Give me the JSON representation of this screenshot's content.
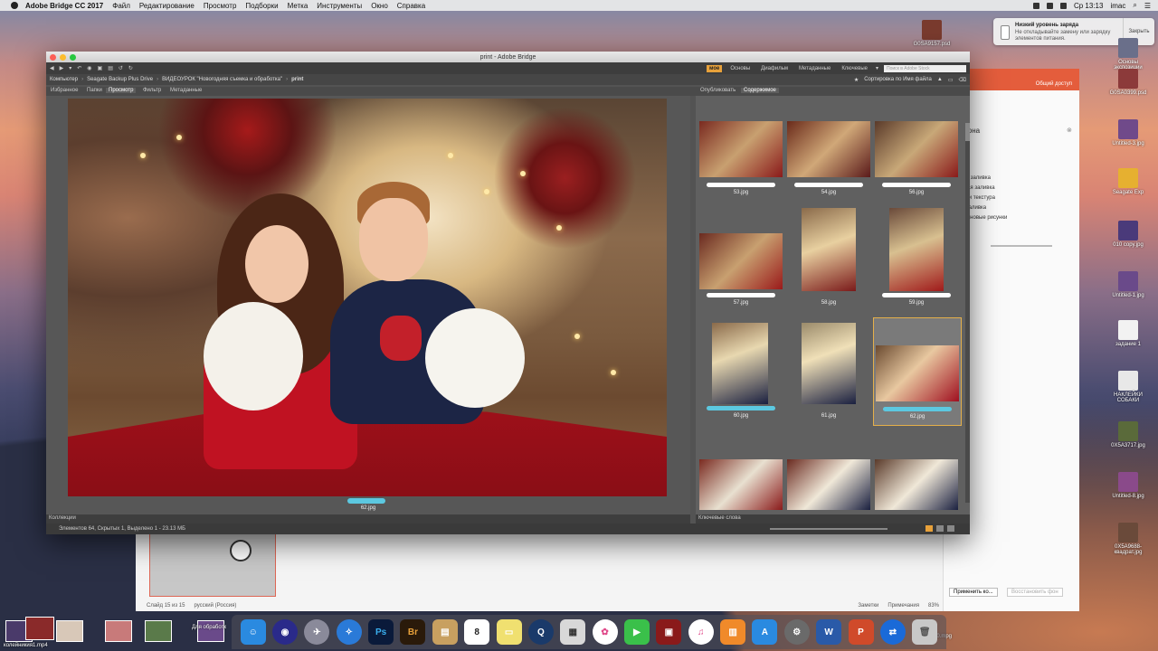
{
  "menubar": {
    "app": "Adobe Bridge CC 2017",
    "items": [
      "Файл",
      "Редактирование",
      "Просмотр",
      "Подборки",
      "Метка",
      "Инструменты",
      "Окно",
      "Справка"
    ],
    "clock": "Ср 13:13",
    "user": "imac"
  },
  "notification": {
    "title": "Низкий уровень заряда",
    "body": "Не откладывайте замену или зарядку элементов питания.",
    "button": "Закрыть"
  },
  "desktop_icons": [
    {
      "label": "G0SA9157.psd"
    },
    {
      "label": "Основы экспозиции"
    },
    {
      "label": "G0SA0399.psd"
    },
    {
      "label": "Untitled-3.jpg"
    },
    {
      "label": "Seagate Exp"
    },
    {
      "label": "010 copy.jpg"
    },
    {
      "label": "Untitled-1.jpg"
    },
    {
      "label": "задание 1"
    },
    {
      "label": "НАКЛЕЙКИ СОБАКИ"
    },
    {
      "label": "0X5A3717.jpg"
    },
    {
      "label": "Untitled-8.jpg"
    },
    {
      "label": "0X5A9688-квадрат.jpg"
    }
  ],
  "window": {
    "title": "print - Adobe Bridge"
  },
  "toolbar": {
    "workspaces": [
      "мое",
      "Основы",
      "Диафильм",
      "Метаданные",
      "Ключевые"
    ],
    "search_placeholder": "Поиск в Adobe Stock"
  },
  "path": {
    "items": [
      "Компьютер",
      "Seagate Backup Plus Drive",
      "ВИДЕОУРОК \"Новогодняя съемка и обработка\"",
      "print"
    ],
    "sort": "Сортировка по Имя файла"
  },
  "left_tabs": [
    "Избранное",
    "Папки",
    "Просмотр",
    "Фильтр",
    "Метаданные"
  ],
  "right_tabs": [
    "Опубликовать",
    "Содержимое"
  ],
  "preview": {
    "filename": "62.jpg"
  },
  "panels": {
    "collections": "Коллекции",
    "keywords": "Ключевые слова"
  },
  "status": "Элементов 64, Скрытых 1, Выделено 1 - 23.13 МБ",
  "thumbnails": [
    {
      "name": "53.jpg",
      "bar": "white"
    },
    {
      "name": "54.jpg",
      "bar": "white"
    },
    {
      "name": "56.jpg",
      "bar": "white"
    },
    {
      "name": "57.jpg",
      "bar": "white"
    },
    {
      "name": "58.jpg",
      "bar": "none"
    },
    {
      "name": "59.jpg",
      "bar": "white"
    },
    {
      "name": "60.jpg",
      "bar": "cyan"
    },
    {
      "name": "61.jpg",
      "bar": "none"
    },
    {
      "name": "62.jpg",
      "bar": "cyan",
      "selected": true
    }
  ],
  "ppt": {
    "share": "Общий доступ",
    "slide_status": "Слайд 15 из 15",
    "lang": "русский (Россия)",
    "notes": "Заметки",
    "comments": "Примечания",
    "zoom": "83%",
    "apply_btn": "Применить ко...",
    "restore_btn": "Восстановить фон",
    "panel_title": "ат фона",
    "options": [
      "ошная заливка",
      "иентная заливка",
      "нок или текстура",
      "рная заливка",
      "ить фоновые рисунки"
    ]
  },
  "dock": [
    "Finder",
    "Siri",
    "Launchpad",
    "Safari",
    "Ps",
    "Br",
    "Notes",
    "8",
    "Stickies",
    "QuickTime",
    "Preview",
    "Photos",
    "FaceTime",
    "Photo Booth",
    "iTunes",
    "iBooks",
    "App Store",
    "System Preferences",
    "W",
    "P",
    "TeamViewer",
    "Trash"
  ],
  "bottom_labels": {
    "left1": "колейникия1.mp4",
    "right1": "02360.mpg",
    "dl": "Для обработк"
  }
}
